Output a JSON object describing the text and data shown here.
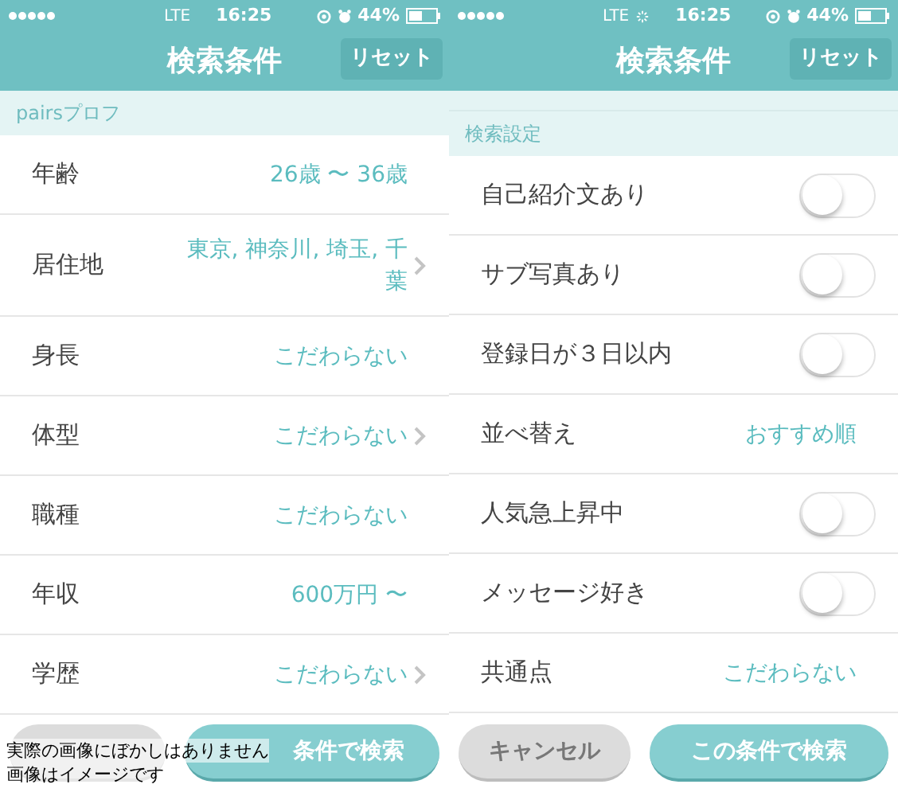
{
  "screens": [
    {
      "status_bar": {
        "network": "LTE",
        "activity": false,
        "time": "16:25",
        "battery": "44%"
      },
      "nav": {
        "title": "検索条件",
        "reset_button": "リセット"
      },
      "sections": [
        {
          "header": "pairsプロフ",
          "rows": [
            {
              "kind": "value",
              "label": "年齢",
              "value": "26歳 〜 36歳",
              "chevron": false
            },
            {
              "kind": "value",
              "label": "居住地",
              "value": "東京, 神奈川, 埼玉, 千葉",
              "chevron": true
            },
            {
              "kind": "value",
              "label": "身長",
              "value": "こだわらない",
              "chevron": false
            },
            {
              "kind": "value",
              "label": "体型",
              "value": "こだわらない",
              "chevron": true
            },
            {
              "kind": "value",
              "label": "職種",
              "value": "こだわらない",
              "chevron": false
            },
            {
              "kind": "value",
              "label": "年収",
              "value": "600万円 〜",
              "chevron": false
            },
            {
              "kind": "value",
              "label": "学歴",
              "value": "こだわらない",
              "chevron": true
            }
          ]
        }
      ],
      "buttons": [
        {
          "kind": "cancel"
        },
        {
          "kind": "search",
          "label": "条件で検索"
        }
      ]
    },
    {
      "status_bar": {
        "network": "LTE",
        "activity": true,
        "time": "16:25",
        "battery": "44%"
      },
      "nav": {
        "title": "検索条件",
        "reset_button": "リセット"
      },
      "sections": [
        {
          "header": "検索設定",
          "rows": [
            {
              "kind": "toggle",
              "label": "自己紹介文あり",
              "on": false
            },
            {
              "kind": "toggle",
              "label": "サブ写真あり",
              "on": false
            },
            {
              "kind": "toggle",
              "label": "登録日が３日以内",
              "on": false
            },
            {
              "kind": "value",
              "label": "並べ替え",
              "value": "おすすめ順",
              "chevron": false
            },
            {
              "kind": "toggle",
              "label": "人気急上昇中",
              "on": false
            },
            {
              "kind": "toggle",
              "label": "メッセージ好き",
              "on": false
            },
            {
              "kind": "value",
              "label": "共通点",
              "value": "こだわらない",
              "chevron": false
            }
          ]
        }
      ],
      "buttons": [
        {
          "kind": "cancel",
          "label": "キャンセル"
        },
        {
          "kind": "search",
          "label": "この条件で検索"
        }
      ]
    }
  ],
  "caption": [
    "実際の画像にぼかしはありません",
    "画像はイメージです"
  ]
}
